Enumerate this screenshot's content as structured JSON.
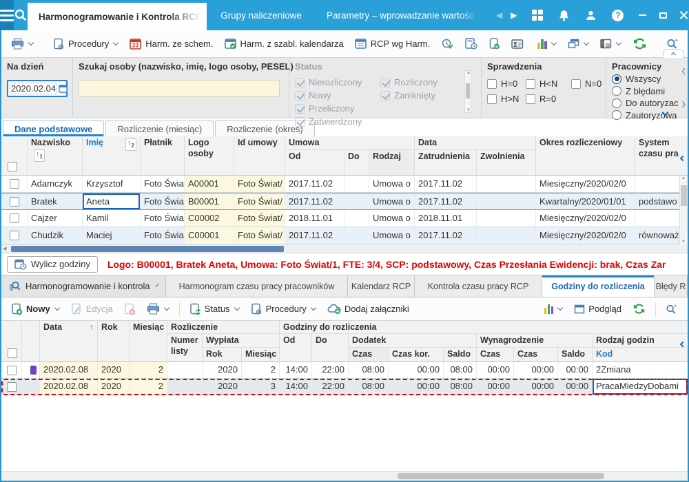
{
  "colors": {
    "topbar": "#2aa0d8",
    "accent": "#1565c0",
    "green": "#2fa052",
    "alert_red": "#e30000",
    "row_alt": "#e9f1f8",
    "cell_yellow": "#fcf8df",
    "selected_row": "#e3e9ee",
    "marker_purple": "#6f42c1"
  },
  "icons": {
    "hamburger-icon": "three bars",
    "search-icon": "magnifier",
    "apps-grid-icon": "2x2 squares",
    "bell-icon": "bell",
    "user-icon": "person",
    "help-icon": "?",
    "minimize-icon": "bar",
    "maximize-icon": "square",
    "close-icon": "x",
    "print-icon": "printer",
    "calendar-23-icon": "calendar 23",
    "calendar-check-icon": "calendar+check",
    "calendar-grid-icon": "calendar grid",
    "clock-check-icon": "clock+check",
    "calculator-clock-icon": "calculator+clock",
    "tablet-check-icon": "tablet+check",
    "person-card-icon": "id card",
    "chart-icon": "bar chart",
    "cascade-windows-icon": "stacked windows",
    "alerts-icon": "panel with !",
    "refresh-icon": "green circular arrows",
    "zoom-icon": "magnifier+sparkle",
    "chevron-down-icon": "v",
    "sort-asc-icon": "green up arrow",
    "doc-plus-icon": "document+plus",
    "pencil-icon": "pencil",
    "doc-delete-icon": "document+x",
    "doc-refresh-icon": "document+refresh",
    "doc-gear-icon": "document+gear",
    "cloud-plus-icon": "cloud+plus",
    "window-icon": "window",
    "calendar-clock-icon": "calendar+clock",
    "search-doc-icon": "magnifier over document"
  },
  "topbar": {
    "tabs": [
      {
        "label": "Harmonogramowanie i Kontrola RCP"
      },
      {
        "label": "Grupy naliczeniowe"
      },
      {
        "label": "Parametry – wprowadzanie wartośc"
      }
    ]
  },
  "toolbar1": {
    "procedury": "Procedury",
    "harm_ze_schem": "Harm. ze schem.",
    "harm_z_szabl": "Harm. z szabl. kalendarza",
    "rcp_wg_harm": "RCP wg Harm."
  },
  "filters": {
    "na_dzien": {
      "label": "Na dzień",
      "value": "2020.02.04"
    },
    "szukaj": {
      "label": "Szukaj osoby (nazwisko, imię, logo osoby, PESEL)",
      "value": ""
    },
    "status": {
      "label": "Status",
      "col1": [
        "Nierozliczony",
        "Nowy",
        "Przeliczony",
        "Zatwierdzony"
      ],
      "col2": [
        "Rozliczony",
        "Zamknięty"
      ]
    },
    "sprawdzenia": {
      "label": "Sprawdzenia",
      "row1": [
        "H=0",
        "H<N",
        "N=0"
      ],
      "row2": [
        "H>N",
        "R=0"
      ]
    },
    "pracownicy": {
      "label": "Pracownicy",
      "options": [
        "Wszyscy",
        "Z błędami",
        "Do autoryzac",
        "Zautoryzowa"
      ],
      "selected": "Wszyscy"
    }
  },
  "tabs1": [
    {
      "label": "Dane podstawowe"
    },
    {
      "label": "Rozliczenie (miesiąc)"
    },
    {
      "label": "Rozliczenie (okres)"
    }
  ],
  "table1": {
    "headers": {
      "nazwisko": "Nazwisko",
      "imie": "Imię",
      "platnik": "Płatnik",
      "logo_osoby": "Logo osoby",
      "id_umowy": "Id umowy",
      "umowa": "Umowa",
      "od": "Od",
      "do": "Do",
      "rodzaj": "Rodzaj",
      "data": "Data",
      "zatrudnienia": "Zatrudnienia",
      "zwolnienia": "Zwolnienia",
      "okres": "Okres rozliczeniowy",
      "system": "System czasu pra",
      "sort1": "1",
      "sort2": "2"
    },
    "rows": [
      {
        "nazwisko": "Adamczyk",
        "imie": "Krzysztof",
        "platnik": "Foto Świa",
        "logo": "A00001",
        "id_umowy": "Foto Świat/",
        "od": "2017.11.02",
        "do": "",
        "rodzaj": "Umowa o",
        "zatrudnienia": "2017.11.02",
        "zwolnienia": "",
        "okres": "Miesięczny/2020/02/0",
        "system": ""
      },
      {
        "nazwisko": "Bratek",
        "imie": "Aneta",
        "platnik": "Foto Świa",
        "logo": "B00001",
        "id_umowy": "Foto Świat/",
        "od": "2017.11.02",
        "do": "",
        "rodzaj": "Umowa o",
        "zatrudnienia": "2017.11.02",
        "zwolnienia": "",
        "okres": "Kwartalny/2020/01/01",
        "system": "podstawo"
      },
      {
        "nazwisko": "Cajzer",
        "imie": "Kamil",
        "platnik": "Foto Świa",
        "logo": "C00002",
        "id_umowy": "Foto Świat/",
        "od": "2018.11.01",
        "do": "",
        "rodzaj": "Umowa o",
        "zatrudnienia": "2018.11.01",
        "zwolnienia": "",
        "okres": "Miesięczny/2020/02/0",
        "system": ""
      },
      {
        "nazwisko": "Chudzik",
        "imie": "Maciej",
        "platnik": "Foto Świa",
        "logo": "C00001",
        "id_umowy": "Foto Świat/",
        "od": "2017.11.02",
        "do": "",
        "rodzaj": "Umowa o",
        "zatrudnienia": "2017.11.02",
        "zwolnienia": "",
        "okres": "Miesięczny/2020/02/0",
        "system": "równoważ"
      }
    ]
  },
  "status_line": {
    "button": "Wylicz godziny",
    "message": "Logo: B00001, Bratek Aneta, Umowa: Foto Świat/1, FTE: 3/4, SCP: podstawowy, Czas Przesłania Ewidencji: brak, Czas Zar"
  },
  "section2": {
    "selector": "Harmonogramowanie i kontrola",
    "tabs": [
      {
        "label": "Harmonogram czasu pracy pracowników"
      },
      {
        "label": "Kalendarz RCP"
      },
      {
        "label": "Kontrola czasu pracy RCP"
      },
      {
        "label": "Godziny do rozliczenia"
      },
      {
        "label": "Błędy R"
      }
    ],
    "toolbar": {
      "nowy": "Nowy",
      "edycja": "Edycja",
      "status": "Status",
      "procedury": "Procedury",
      "dodaj_zalaczniki": "Dodaj załączniki",
      "podglad": "Podgląd"
    },
    "table2": {
      "headers": {
        "data": "Data",
        "rok": "Rok",
        "miesiac": "Miesiąc",
        "rozliczenie": "Rozliczenie",
        "numer_listy": "Numer listy",
        "wyplata": "Wypłata",
        "godziny": "Godziny do rozliczenia",
        "od": "Od",
        "do": "Do",
        "dodatek": "Dodatek",
        "wynagrodzenie": "Wynagrodzenie",
        "czas": "Czas",
        "czas_kor": "Czas kor.",
        "saldo": "Saldo",
        "rodzaj_godzin": "Rodzaj godzin",
        "kod": "Kod"
      },
      "rows": [
        {
          "data": "2020.02.08",
          "rok": "2020",
          "miesiac": "2",
          "numer_listy": "",
          "wyplata_rok": "2020",
          "wyplata_miesiac": "2",
          "od": "14:00",
          "do": "22:00",
          "dodatek_czas": "08:00",
          "dodatek_czas_kor": "00:00",
          "dodatek_saldo": "08:00",
          "wyn_czas": "00:00",
          "wyn_czas_kor": "00:00",
          "wyn_saldo": "00:00",
          "kod": "2Zmiana"
        },
        {
          "data": "2020.02.08",
          "rok": "2020",
          "miesiac": "2",
          "numer_listy": "",
          "wyplata_rok": "2020",
          "wyplata_miesiac": "3",
          "od": "14:00",
          "do": "22:00",
          "dodatek_czas": "08:00",
          "dodatek_czas_kor": "00:00",
          "dodatek_saldo": "08:00",
          "wyn_czas": "00:00",
          "wyn_czas_kor": "00:00",
          "wyn_saldo": "00:00",
          "kod": "PracaMiedzyDobami"
        }
      ]
    }
  }
}
